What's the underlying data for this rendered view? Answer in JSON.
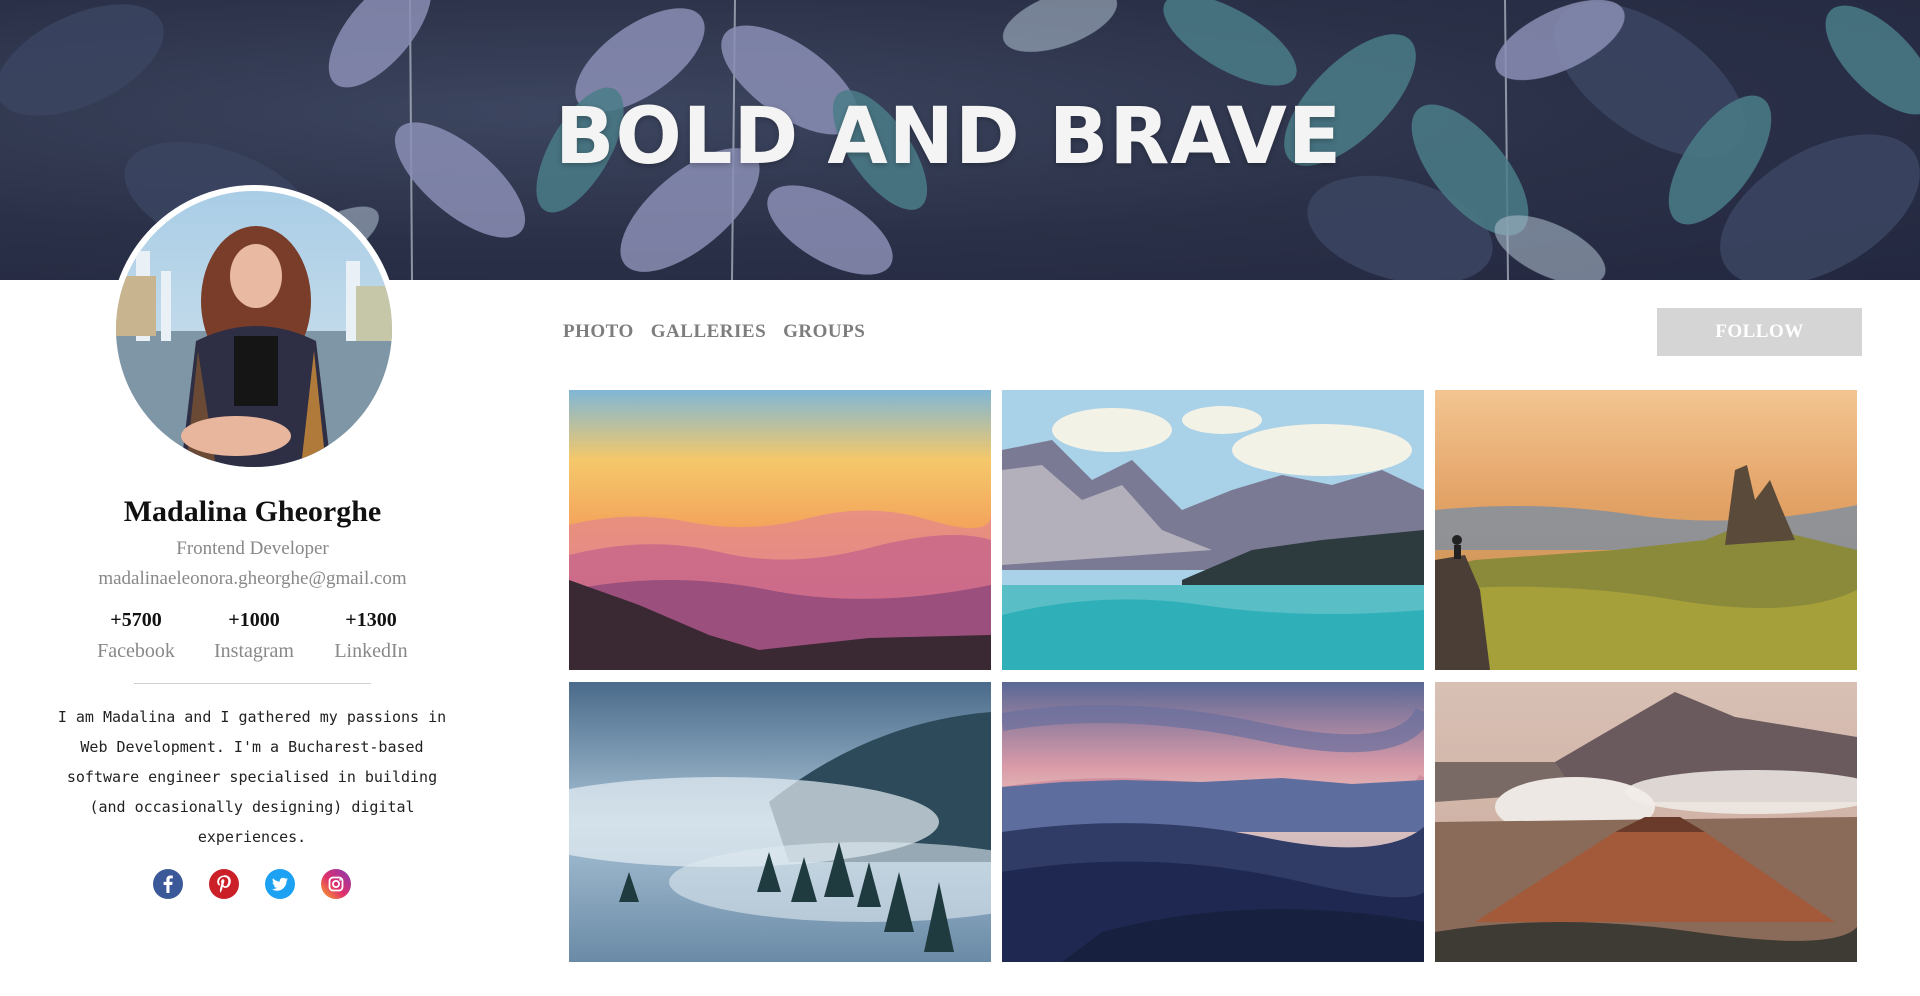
{
  "banner": {
    "title": "BOLD AND BRAVE"
  },
  "profile": {
    "name": "Madalina Gheorghe",
    "role": "Frontend Developer",
    "email": "madalinaeleonora.gheorghe@gmail.com",
    "stats": [
      {
        "value": "+5700",
        "label": "Facebook"
      },
      {
        "value": "+1000",
        "label": "Instagram"
      },
      {
        "value": "+1300",
        "label": "LinkedIn"
      }
    ],
    "bio": [
      "I am Madalina and I gathered my passions in",
      "Web Development. I'm a Bucharest-based",
      "software engineer specialised in building",
      "(and occasionally designing) digital",
      "experiences."
    ],
    "socials": [
      "facebook-icon",
      "pinterest-icon",
      "twitter-icon",
      "instagram-icon"
    ]
  },
  "nav": {
    "tabs": [
      "PHOTO",
      "GALLERIES",
      "GROUPS"
    ],
    "follow_label": "FOLLOW"
  },
  "colors": {
    "banner_bg": "#2a3047",
    "follow_bg": "#d5d5d5",
    "tab_text": "#7d7d7d",
    "muted_text": "#888888",
    "facebook": "#3b5998",
    "pinterest": "#cb2027",
    "twitter": "#1da1f2",
    "instagram": "#e1306c"
  }
}
